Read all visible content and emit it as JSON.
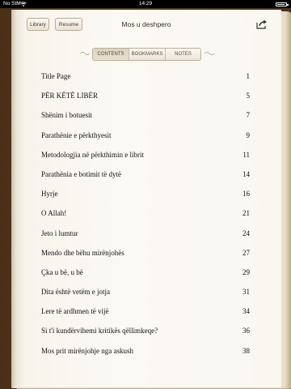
{
  "status_bar": {
    "carrier": "No SIM",
    "time": "14:29"
  },
  "toolbar": {
    "library_label": "Library",
    "resume_label": "Resume",
    "book_title": "Mos u deshpero"
  },
  "tabs": [
    {
      "label": "CONTENTS",
      "active": true
    },
    {
      "label": "BOOKMARKS",
      "active": false
    },
    {
      "label": "NOTES",
      "active": false
    }
  ],
  "toc": [
    {
      "title": "Title Page",
      "page": "1"
    },
    {
      "title": "PËR KËTË LIBËR",
      "page": "5"
    },
    {
      "title": "Shënim i botuesit",
      "page": "7"
    },
    {
      "title": "Parathënie e përkthyesit",
      "page": "9"
    },
    {
      "title": "Metodologjia në përkthimin e librit",
      "page": "11"
    },
    {
      "title": "Parathënia e botimit të dytë",
      "page": "14"
    },
    {
      "title": "Hyrje",
      "page": "16"
    },
    {
      "title": "O Allah!",
      "page": "21"
    },
    {
      "title": "Jeto i lumtur",
      "page": "24"
    },
    {
      "title": "Mendo dhe bëhu mirënjohës",
      "page": "27"
    },
    {
      "title": "Çka u bë, u bë",
      "page": "29"
    },
    {
      "title": "Dita është vetëm e jotja",
      "page": "31"
    },
    {
      "title": "Lere të ardhmen të vijë",
      "page": "34"
    },
    {
      "title": "Si t'i kundërvihemi kritikës qëllimkeqe?",
      "page": "36"
    },
    {
      "title": "Mos prit mirënjohje nga askush",
      "page": "38"
    }
  ]
}
